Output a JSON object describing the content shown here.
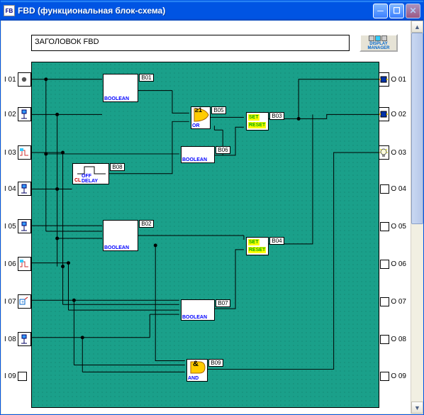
{
  "window": {
    "title": "FBD (функциональная блок-схема)"
  },
  "header": {
    "title_value": "ЗАГОЛОВОК FBD",
    "display_manager": "DISPLAY\nMANAGER"
  },
  "inputs": [
    {
      "id": "I 01",
      "icon": "dot"
    },
    {
      "id": "I 02",
      "icon": "switch-blue"
    },
    {
      "id": "I 03",
      "icon": "pulse"
    },
    {
      "id": "I 04",
      "icon": "switch-blue"
    },
    {
      "id": "I 05",
      "icon": "switch-blue"
    },
    {
      "id": "I 06",
      "icon": "pulse"
    },
    {
      "id": "I 07",
      "icon": "plus"
    },
    {
      "id": "I 08",
      "icon": "switch-blue"
    },
    {
      "id": "I 09",
      "icon": "none"
    }
  ],
  "outputs": [
    {
      "id": "O 01",
      "icon": "lamp-blue"
    },
    {
      "id": "O 02",
      "icon": "lamp-blue"
    },
    {
      "id": "O 03",
      "icon": "bulb"
    },
    {
      "id": "O 04",
      "icon": "none-sm"
    },
    {
      "id": "O 05",
      "icon": "none-sm"
    },
    {
      "id": "O 06",
      "icon": "none-sm"
    },
    {
      "id": "O 07",
      "icon": "none-sm"
    },
    {
      "id": "O 08",
      "icon": "none-sm"
    },
    {
      "id": "O 09",
      "icon": "none-sm"
    }
  ],
  "blocks": {
    "B01": {
      "label": "BOOLEAN",
      "tag": "B01"
    },
    "B02": {
      "label": "BOOLEAN",
      "tag": "B02"
    },
    "B05": {
      "label": "OR",
      "sym": "≥1",
      "tag": "B05"
    },
    "B06": {
      "label": "BOOLEAN",
      "tag": "B06"
    },
    "B07": {
      "label": "BOOLEAN",
      "tag": "B07"
    },
    "B08": {
      "label": "OFF DELAY",
      "icon_hint": "CL",
      "tag": "B08"
    },
    "B09": {
      "label": "AND",
      "sym": "&",
      "tag": "B09"
    },
    "B03": {
      "set": "SET",
      "reset": "RESET",
      "tag": "B03"
    },
    "B04": {
      "set": "SET",
      "reset": "RESET",
      "tag": "B04"
    }
  }
}
